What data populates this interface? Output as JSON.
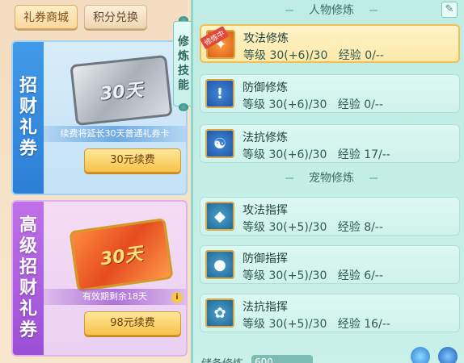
{
  "tabs": [
    {
      "label": "礼券商城",
      "active": true
    },
    {
      "label": "积分兑换",
      "active": false
    }
  ],
  "cards": [
    {
      "vertical_title": [
        "招",
        "财",
        "礼",
        "券"
      ],
      "ticket_text": "30天",
      "info": "续费将延长30天普通礼券卡",
      "button": "30元续费"
    },
    {
      "vertical_title": [
        "高",
        "级",
        "招",
        "财",
        "礼",
        "券"
      ],
      "ticket_text": "30天",
      "info": "有效期剩余18天",
      "info_icon": "i",
      "button": "98元续费"
    }
  ],
  "side_tab": {
    "chars": [
      "修",
      "炼",
      "技",
      "能"
    ]
  },
  "sections": {
    "character": "人物修炼",
    "pet": "宠物修炼"
  },
  "character_rows": [
    {
      "name": "攻法修炼",
      "level_label": "等级",
      "level": "30(+6)/30",
      "exp_label": "经验",
      "exp": "0/--",
      "badge": "修炼中",
      "selected": true,
      "icon": "flame-icon"
    },
    {
      "name": "防御修炼",
      "level_label": "等级",
      "level": "30(+6)/30",
      "exp_label": "经验",
      "exp": "0/--",
      "selected": false,
      "icon": "shield-icon"
    },
    {
      "name": "法抗修炼",
      "level_label": "等级",
      "level": "30(+6)/30",
      "exp_label": "经验",
      "exp": "17/--",
      "selected": false,
      "icon": "yinyang-icon"
    }
  ],
  "pet_rows": [
    {
      "name": "攻法指挥",
      "level_label": "等级",
      "level": "30(+5)/30",
      "exp_label": "经验",
      "exp": "8/--",
      "icon": "pet-flame-icon"
    },
    {
      "name": "防御指挥",
      "level_label": "等级",
      "level": "30(+5)/30",
      "exp_label": "经验",
      "exp": "6/--",
      "icon": "pet-shield-icon"
    },
    {
      "name": "法抗指挥",
      "level_label": "等级",
      "level": "30(+5)/30",
      "exp_label": "经验",
      "exp": "16/--",
      "icon": "pet-paw-icon"
    }
  ],
  "bottom": {
    "label": "储备修炼",
    "value": "600"
  },
  "colors": {
    "accent": "#f0c054",
    "panel": "#bfece4"
  }
}
